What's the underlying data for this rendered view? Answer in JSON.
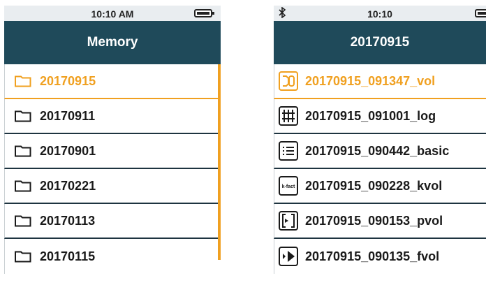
{
  "left_screen": {
    "status": {
      "time": "10:10 AM"
    },
    "header": {
      "title": "Memory"
    },
    "folders": [
      {
        "name": "20170915",
        "selected": true
      },
      {
        "name": "20170911",
        "selected": false
      },
      {
        "name": "20170901",
        "selected": false
      },
      {
        "name": "20170221",
        "selected": false
      },
      {
        "name": "20170113",
        "selected": false
      },
      {
        "name": "20170115",
        "selected": false
      }
    ]
  },
  "right_screen": {
    "status": {
      "time": "10:10"
    },
    "header": {
      "title": "20170915"
    },
    "files": [
      {
        "name": "20170915_091347_vol",
        "icon": "vol-icon",
        "selected": true
      },
      {
        "name": "20170915_091001_log",
        "icon": "log-icon",
        "selected": false
      },
      {
        "name": "20170915_090442_basic",
        "icon": "basic-icon",
        "selected": false
      },
      {
        "name": "20170915_090228_kvol",
        "icon": "kfact-icon",
        "icon_text": "k-fact",
        "selected": false
      },
      {
        "name": "20170915_090153_pvol",
        "icon": "pvol-icon",
        "selected": false
      },
      {
        "name": "20170915_090135_fvol",
        "icon": "fvol-icon",
        "selected": false
      }
    ]
  },
  "colors": {
    "header_bg": "#1f4a5a",
    "accent": "#f0a020",
    "text": "#1a1a1a",
    "status_bg": "#e9edf0"
  }
}
